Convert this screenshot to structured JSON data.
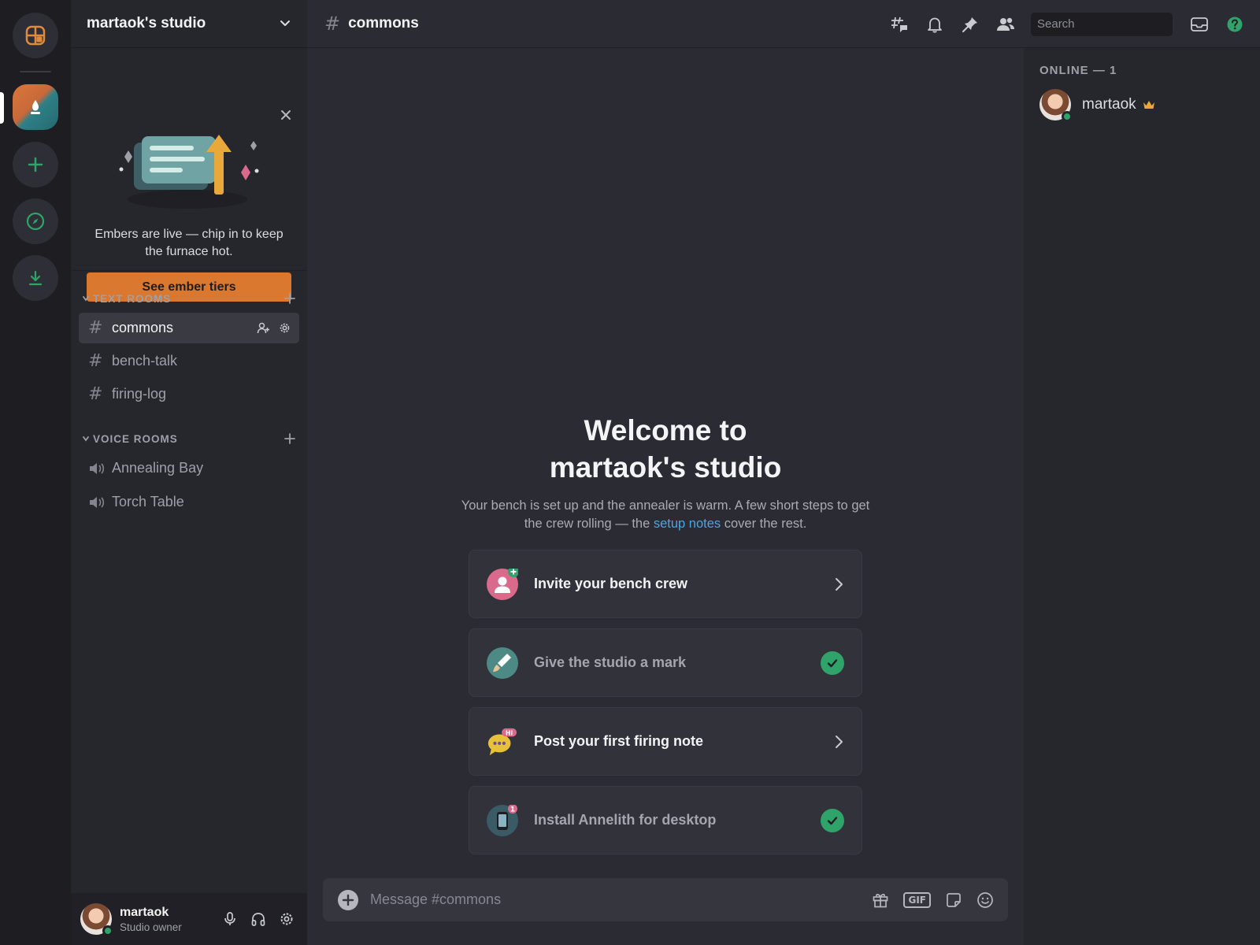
{
  "server": {
    "name": "martaok's studio"
  },
  "promo": {
    "text": "Embers are live — chip in to keep the furnace hot.",
    "button_label": "See ember tiers"
  },
  "categories": {
    "text": {
      "label": "TEXT ROOMS"
    },
    "voice": {
      "label": "VOICE ROOMS"
    }
  },
  "text_channels": [
    {
      "name": "commons",
      "active": true
    },
    {
      "name": "bench-talk"
    },
    {
      "name": "firing-log"
    }
  ],
  "voice_channels": [
    {
      "name": "Annealing Bay"
    },
    {
      "name": "Torch Table"
    }
  ],
  "user": {
    "name": "martaok",
    "subtitle": "Studio owner"
  },
  "topbar": {
    "channel": "commons",
    "search_placeholder": "Search"
  },
  "welcome": {
    "title_line1": "Welcome to",
    "title_line2": "martaok's studio",
    "subtitle_before": "Your bench is set up and the annealer is warm. A few short steps to get the crew rolling — the ",
    "subtitle_link": "setup notes",
    "subtitle_after": " cover the rest."
  },
  "cards": [
    {
      "label": "Invite your bench crew",
      "done": false,
      "icon": "invite-icon"
    },
    {
      "label": "Give the studio a mark",
      "done": true,
      "icon": "brush-icon"
    },
    {
      "label": "Post your first firing note",
      "done": false,
      "icon": "chat-bubble-icon"
    },
    {
      "label": "Install Annelith for desktop",
      "done": true,
      "icon": "phone-icon"
    }
  ],
  "composer": {
    "placeholder": "Message #commons",
    "gif_label": "GIF"
  },
  "members": {
    "header": "ONLINE — 1",
    "list": [
      {
        "name": "martaok",
        "role": "owner"
      }
    ]
  },
  "colors": {
    "accent_orange": "#d9782e",
    "online_green": "#2fa36a",
    "link_blue": "#4ca6e0",
    "crown_gold": "#e8a93a"
  }
}
